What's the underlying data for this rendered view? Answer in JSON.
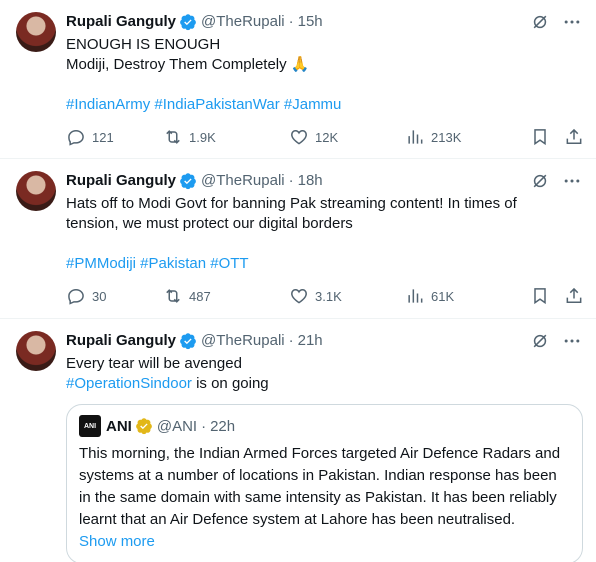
{
  "tweets": [
    {
      "name": "Rupali Ganguly",
      "handle": "@TheRupali",
      "time": "15h",
      "lines": [
        "ENOUGH IS ENOUGH",
        "Modiji, Destroy Them Completely 🙏"
      ],
      "hashtags": "#IndianArmy #IndiaPakistanWar #Jammu",
      "replies": "121",
      "retweets": "1.9K",
      "likes": "12K",
      "views": "213K"
    },
    {
      "name": "Rupali Ganguly",
      "handle": "@TheRupali",
      "time": "18h",
      "lines": [
        "Hats off to Modi Govt for banning Pak streaming content! In times of",
        "tension, we must protect our digital borders"
      ],
      "hashtags": "#PMModiji #Pakistan #OTT",
      "replies": "30",
      "retweets": "487",
      "likes": "3.1K",
      "views": "61K"
    },
    {
      "name": "Rupali Ganguly",
      "handle": "@TheRupali",
      "time": "21h",
      "line1": "Every tear will be avenged",
      "hashtag": "#OperationSindoor",
      "line2_rest": " is on going",
      "quote": {
        "avatar_text": "ANI",
        "name": "ANI",
        "handle": "@ANI",
        "time": "22h",
        "text": "This morning, the Indian Armed Forces targeted Air Defence Radars and systems at a number of locations in Pakistan. Indian response has been in the same domain with same intensity as Pakistan. It has been reliably learnt that an Air Defence system at Lahore has been neutralised.",
        "show_more": "Show more"
      }
    }
  ],
  "colors": {
    "accent": "#1d9bf0",
    "muted": "#536471",
    "verified_blue": "#1d9bf0",
    "verified_gold": "#e2b719"
  }
}
